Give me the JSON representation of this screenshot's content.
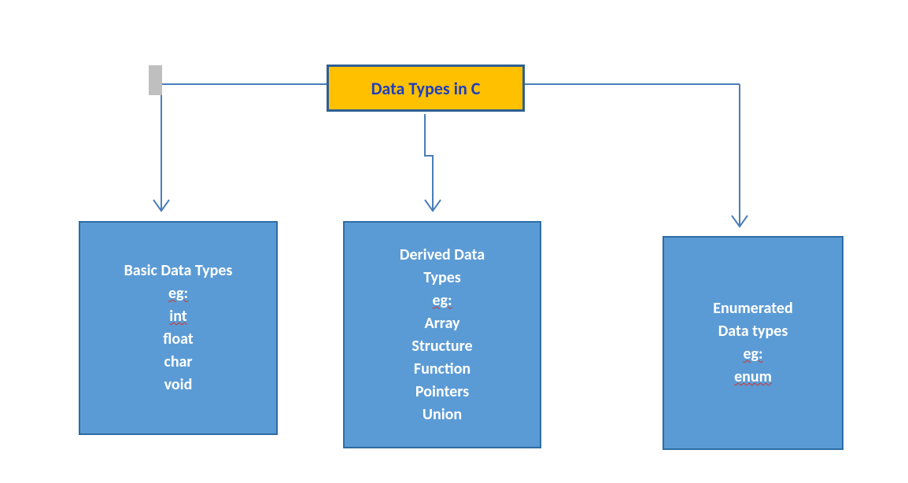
{
  "root": {
    "title": "Data Types in C"
  },
  "children": {
    "basic": {
      "title": "Basic Data Types",
      "eg_label": "eg:",
      "items": [
        "int",
        "float",
        "char",
        "void"
      ]
    },
    "derived": {
      "title": "Derived Data",
      "title2": "Types",
      "eg_label": "eg:",
      "items": [
        "Array",
        "Structure",
        "Function",
        "Pointers",
        "Union"
      ]
    },
    "enum": {
      "title": "Enumerated",
      "title2": "Data types",
      "eg_label": "eg:",
      "items": [
        "enum"
      ]
    }
  }
}
